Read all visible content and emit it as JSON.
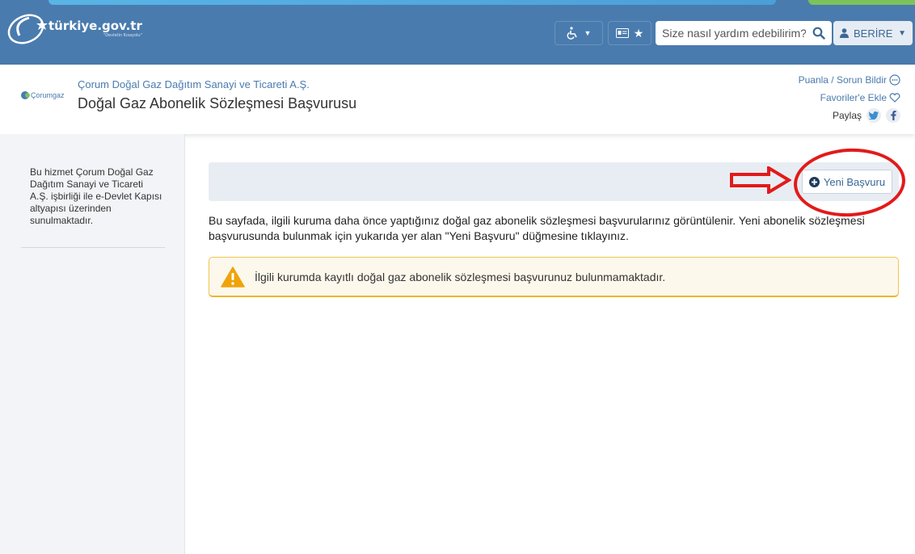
{
  "header": {
    "logo_text": "türkiye.gov.tr",
    "logo_tagline": "\"Devletin Kısayolu\"",
    "search_placeholder": "Size nasıl yardım edebilirim?",
    "user_label": "BERİRE",
    "colors": {
      "header_bg": "#4a7bae",
      "accent_blue": "#5ab4e6",
      "accent_green": "#7cc35a"
    }
  },
  "institution": {
    "logo_label": "Çorumgaz",
    "name": "Çorum Doğal Gaz Dağıtım Sanayi ve Ticareti A.Ş.",
    "service_title": "Doğal Gaz Abonelik Sözleşmesi Başvurusu"
  },
  "side_links": {
    "rate": "Puanla / Sorun Bildir",
    "favorite": "Favoriler'e Ekle",
    "share": "Paylaş"
  },
  "sidebar": {
    "description": "Bu hizmet Çorum Doğal Gaz Dağıtım Sanayi ve Ticareti A.Ş. işbirliği ile e-Devlet Kapısı altyapısı üzerinden sunulmaktadır."
  },
  "main": {
    "new_application_label": "Yeni Başvuru",
    "info_text": "Bu sayfada, ilgili kuruma daha önce yaptığınız doğal gaz abonelik sözleşmesi başvurularınız görüntülenir. Yeni abonelik sözleşmesi başvurusunda bulunmak için yukarıda yer alan \"Yeni Başvuru\" düğmesine tıklayınız.",
    "warning_text": "İlgili kurumda kayıtlı doğal gaz abonelik sözleşmesi başvurunuz bulunmamaktadır.",
    "warning_icon": "warning-triangle-icon",
    "annotation_color": "#e21a1a"
  }
}
